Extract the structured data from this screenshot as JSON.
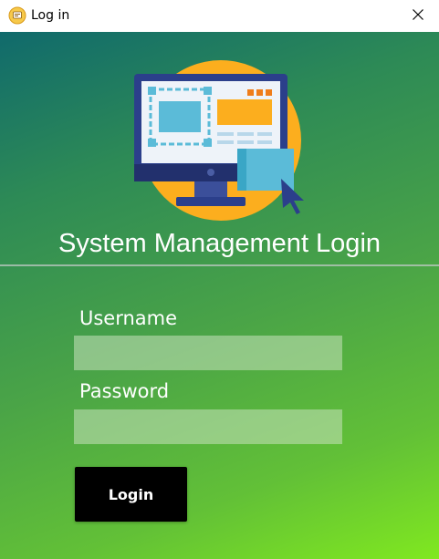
{
  "window": {
    "title": "Log in",
    "title_icon": "lock-icon",
    "close_icon": "close-icon"
  },
  "header": {
    "heading": "System Management Login",
    "illustration": "computer-monitor-icon"
  },
  "form": {
    "username_label": "Username",
    "username_value": "",
    "password_label": "Password",
    "password_value": "",
    "login_label": "Login"
  },
  "colors": {
    "gradient_start": "#106a6c",
    "gradient_end": "#80e820",
    "sun_circle": "#fcae1e",
    "monitor_frame": "#2b3f8b",
    "button_bg": "#000000"
  }
}
